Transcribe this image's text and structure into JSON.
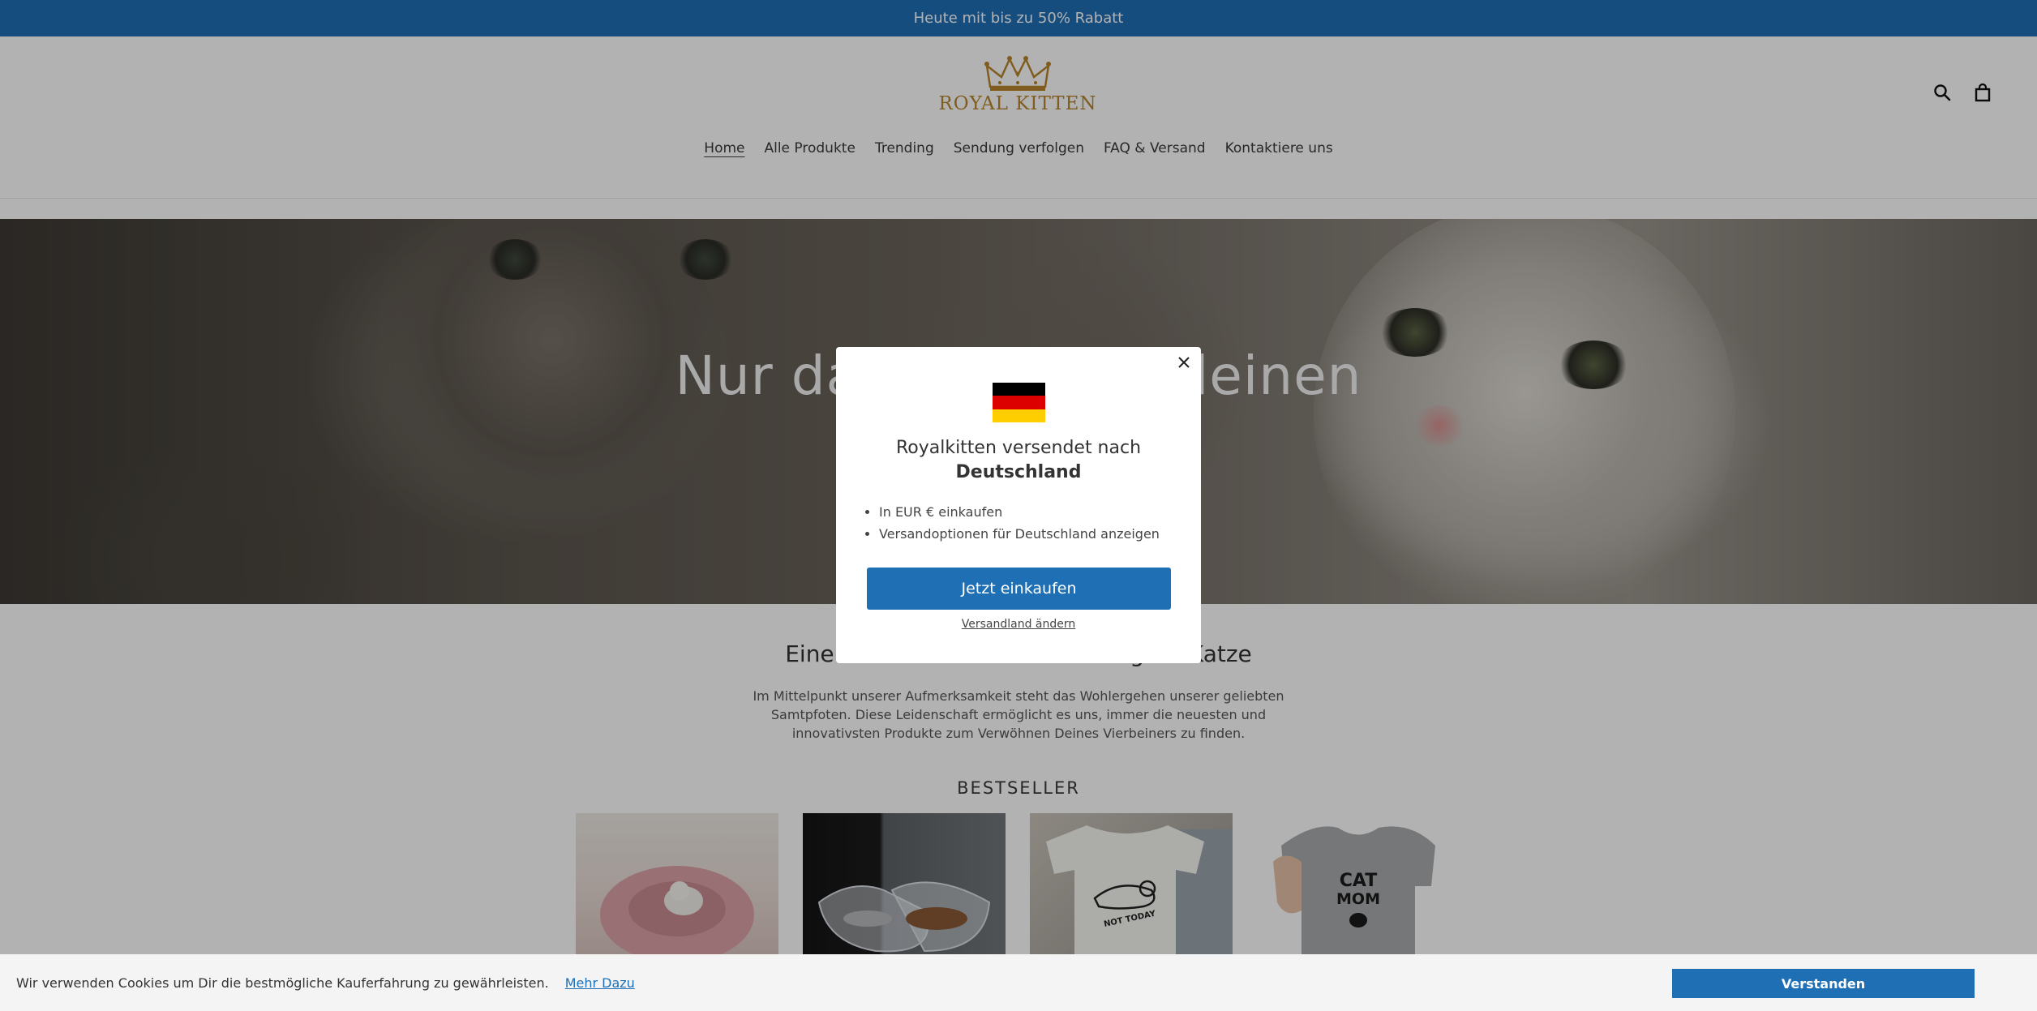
{
  "announcement": {
    "text": "Heute mit bis zu 50% Rabatt"
  },
  "header": {
    "logo_text": "ROYAL KITTEN",
    "icons": [
      "search-icon",
      "cart-icon"
    ],
    "nav": [
      {
        "label": "Home",
        "active": true
      },
      {
        "label": "Alle Produkte"
      },
      {
        "label": "Trending"
      },
      {
        "label": "Sendung verfolgen"
      },
      {
        "label": "FAQ & Versand"
      },
      {
        "label": "Kontaktiere uns"
      }
    ]
  },
  "hero": {
    "title": "Nur das Beste für deinen",
    "subtitle": ""
  },
  "intro": {
    "heading": "Eine zufriedene Katze ist eine gute Katze",
    "body": "Im Mittelpunkt unserer Aufmerksamkeit steht das Wohlergehen unserer geliebten Samtpfoten. Diese Leidenschaft ermöglicht es uns, immer die neuesten und innovativsten Produkte zum Verwöhnen Deines Vierbeiners zu finden."
  },
  "bestseller": {
    "title": "BESTSELLER",
    "tshirt_text": "NOT TODAY",
    "shirt_text_line1": "CAT",
    "shirt_text_line2": "MOM"
  },
  "modal": {
    "heading_line1": "Royalkitten versendet nach",
    "heading_country": "Deutschland",
    "bullets": [
      "In EUR € einkaufen",
      "Versandoptionen für Deutschland anzeigen"
    ],
    "button": "Jetzt einkaufen",
    "change_link": "Versandland ändern",
    "flag_colors": [
      "#000000",
      "#dd0000",
      "#ffce00"
    ]
  },
  "cookie": {
    "text": "Wir verwenden Cookies um Dir die bestmögliche Kauferfahrung zu gewährleisten.",
    "link": "Mehr Dazu",
    "button": "Verstanden"
  },
  "colors": {
    "brand_blue": "#1f6fb5",
    "logo_gold": "#b8862b"
  }
}
